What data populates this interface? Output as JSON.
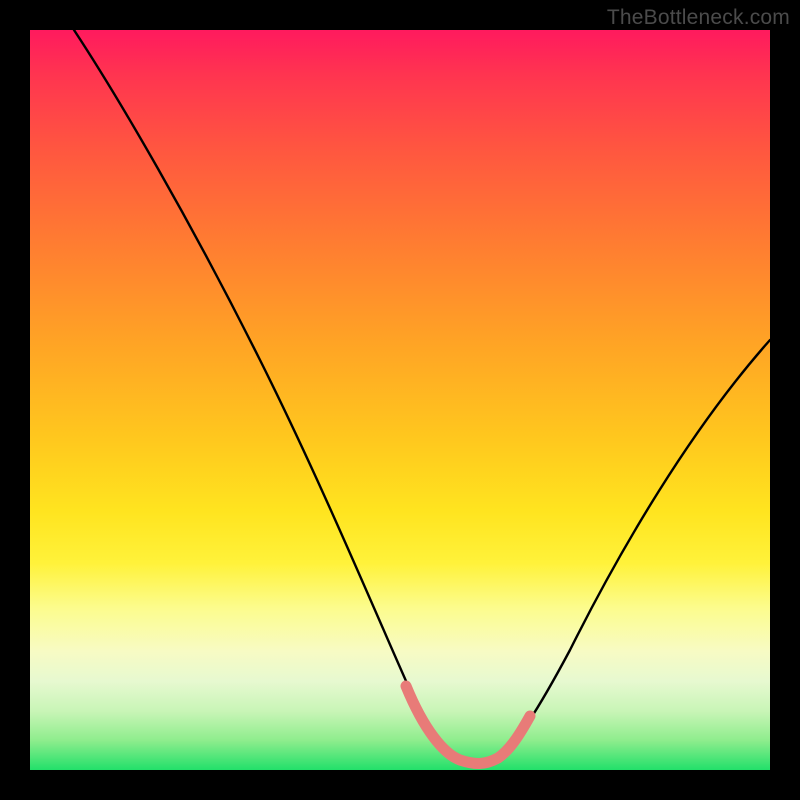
{
  "attribution": "TheBottleneck.com",
  "colors": {
    "frame": "#000000",
    "curve": "#000000",
    "curve_highlight": "#e87b78",
    "gradient_stops": [
      "#ff1a5e",
      "#ff3450",
      "#ff5640",
      "#ff7a32",
      "#ffa325",
      "#ffc71e",
      "#ffe41f",
      "#fff23a",
      "#fcfc8c",
      "#f7fbc4",
      "#e7f9d0",
      "#c9f5b7",
      "#8eed8d",
      "#22e06a"
    ]
  },
  "chart_data": {
    "type": "line",
    "title": "",
    "xlabel": "",
    "ylabel": "",
    "xlim": [
      0,
      100
    ],
    "ylim": [
      0,
      100
    ],
    "x": [
      6,
      10,
      14,
      18,
      22,
      26,
      30,
      34,
      38,
      42,
      46,
      50,
      52,
      54,
      56,
      58,
      60,
      62,
      64,
      68,
      72,
      76,
      80,
      84,
      88,
      92,
      96,
      100
    ],
    "values": [
      100,
      93,
      86,
      79,
      72,
      64,
      56,
      48,
      40,
      32,
      23,
      14,
      9,
      5,
      2,
      1,
      1,
      1,
      2,
      5,
      10,
      16,
      23,
      30,
      37,
      44,
      51,
      58
    ],
    "highlight_range_x": [
      50,
      64
    ],
    "note": "V-shaped curve with flat minimum near x≈55–62; left branch starts at top-left and descends steeply; right branch rises from the valley and exits at right edge near y≈58%. Salmon highlight covers the valley segment."
  }
}
